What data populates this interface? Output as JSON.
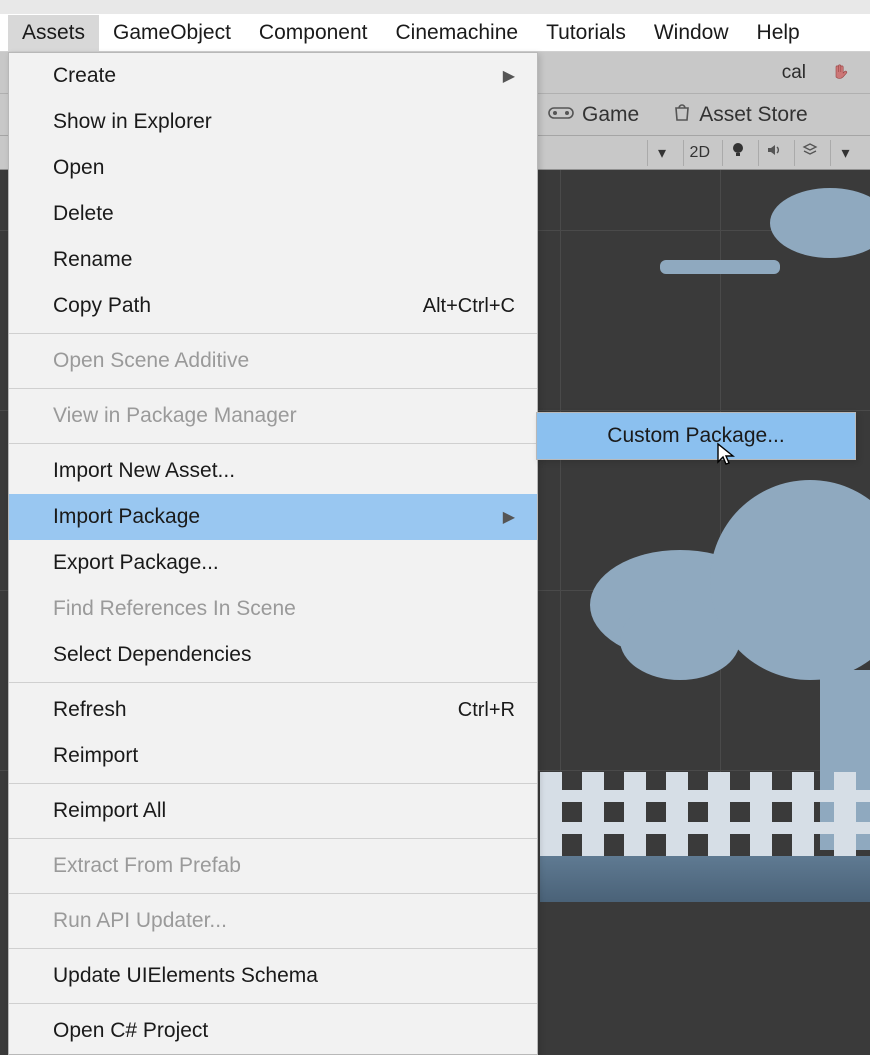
{
  "menubar": {
    "items": [
      "Assets",
      "GameObject",
      "Component",
      "Cinemachine",
      "Tutorials",
      "Window",
      "Help"
    ],
    "active_index": 0
  },
  "toolbar": {
    "pivot_label": "cal",
    "hand_icon": "hand-icon"
  },
  "tabs": {
    "game_label": "Game",
    "asset_store_label": "Asset Store"
  },
  "scene_controls": {
    "dropdown_caret": "▾",
    "mode_2d_label": "2D"
  },
  "dropdown": {
    "items": [
      {
        "label": "Create",
        "submenu": true
      },
      {
        "label": "Show in Explorer"
      },
      {
        "label": "Open"
      },
      {
        "label": "Delete"
      },
      {
        "label": "Rename"
      },
      {
        "label": "Copy Path",
        "shortcut": "Alt+Ctrl+C"
      },
      {
        "sep": true
      },
      {
        "label": "Open Scene Additive",
        "disabled": true
      },
      {
        "sep": true
      },
      {
        "label": "View in Package Manager",
        "disabled": true
      },
      {
        "sep": true
      },
      {
        "label": "Import New Asset..."
      },
      {
        "label": "Import Package",
        "submenu": true,
        "highlighted": true
      },
      {
        "label": "Export Package..."
      },
      {
        "label": "Find References In Scene",
        "disabled": true
      },
      {
        "label": "Select Dependencies"
      },
      {
        "sep": true
      },
      {
        "label": "Refresh",
        "shortcut": "Ctrl+R"
      },
      {
        "label": "Reimport"
      },
      {
        "sep": true
      },
      {
        "label": "Reimport All"
      },
      {
        "sep": true
      },
      {
        "label": "Extract From Prefab",
        "disabled": true
      },
      {
        "sep": true
      },
      {
        "label": "Run API Updater...",
        "disabled": true
      },
      {
        "sep": true
      },
      {
        "label": "Update UIElements Schema"
      },
      {
        "sep": true
      },
      {
        "label": "Open C# Project"
      }
    ]
  },
  "submenu": {
    "items": [
      {
        "label": "Custom Package...",
        "highlighted": true
      }
    ]
  }
}
